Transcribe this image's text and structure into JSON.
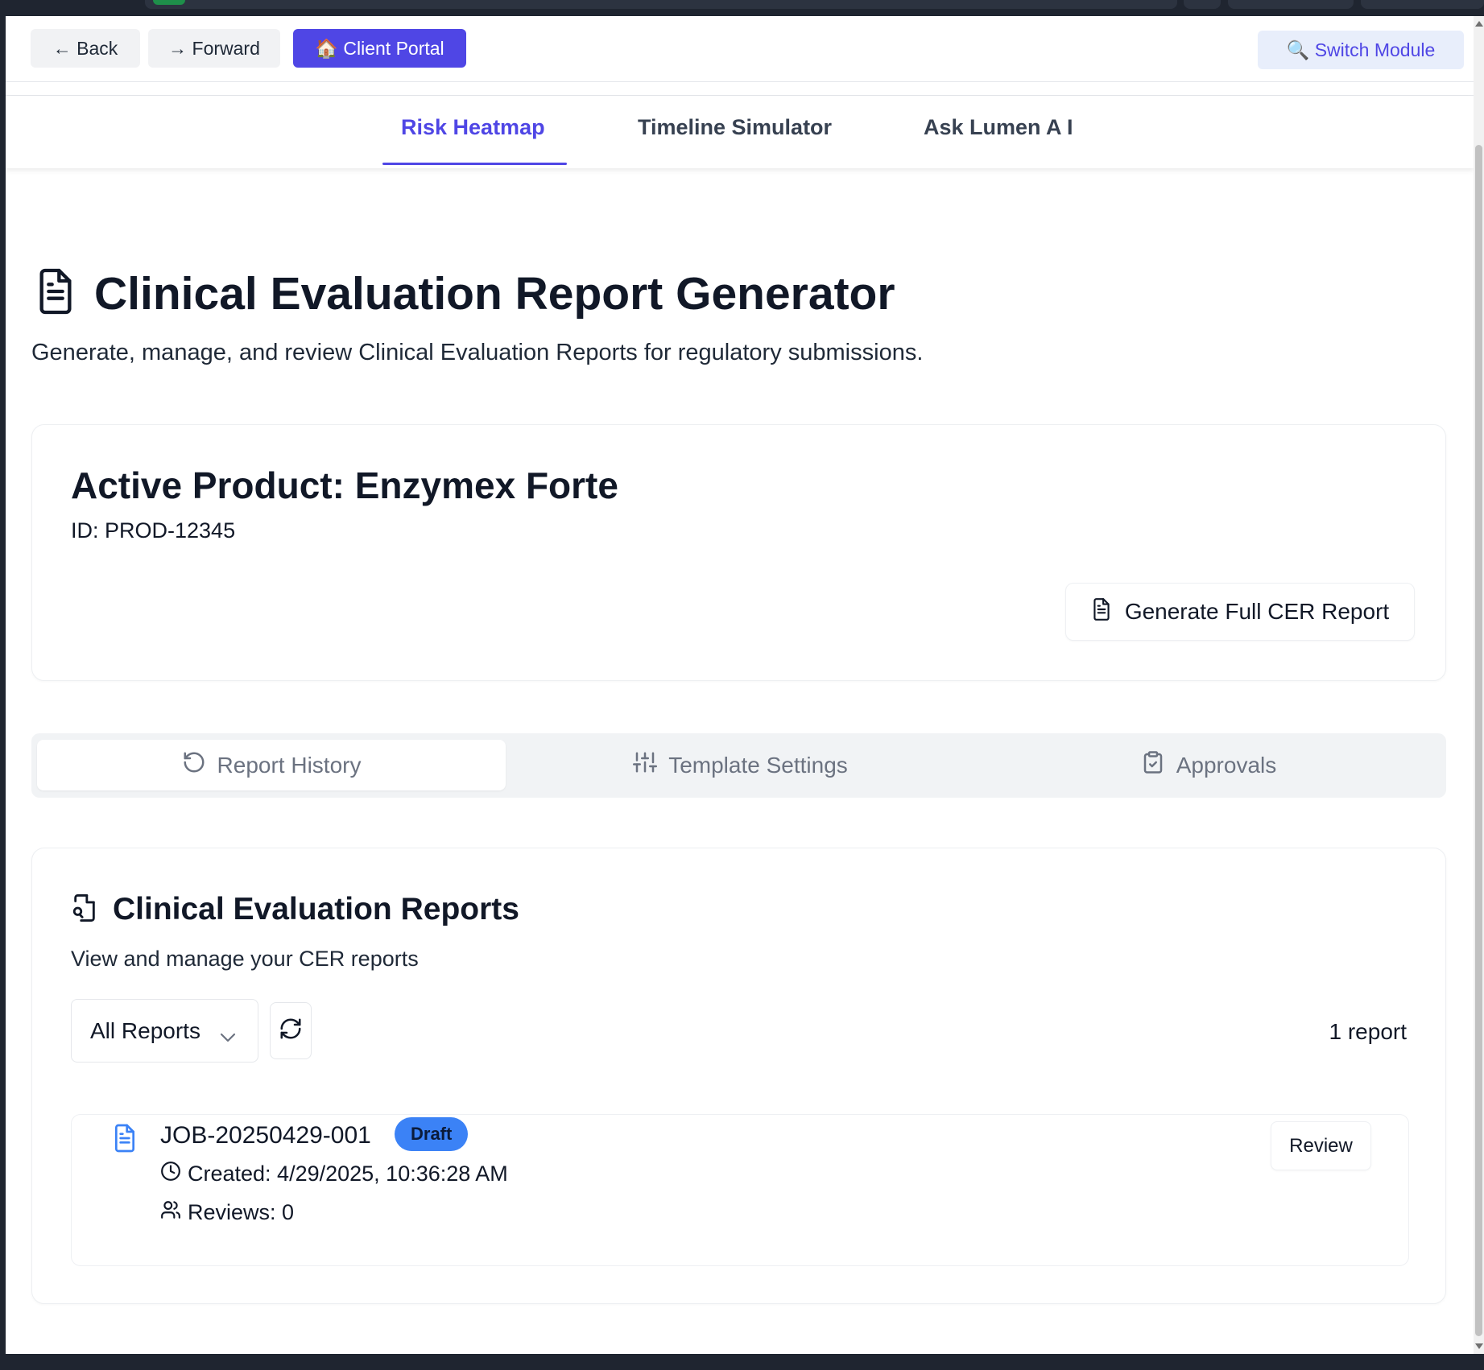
{
  "nav": {
    "back_label": "← Back",
    "forward_label": "→ Forward",
    "portal_label": "🏠 Client Portal",
    "switch_label": "🔍 Switch Module"
  },
  "subnav": {
    "tabs": [
      {
        "label": "Risk Heatmap",
        "active": true
      },
      {
        "label": "Timeline Simulator",
        "active": false
      },
      {
        "label": "Ask Lumen A I",
        "active": false
      }
    ]
  },
  "header": {
    "icon": "file-text-icon",
    "title": "Clinical Evaluation Report Generator",
    "subtitle": "Generate, manage, and review Clinical Evaluation Reports for regulatory submissions."
  },
  "product": {
    "name_line": "Active Product: Enzymex Forte",
    "id_line": "ID: PROD-12345",
    "generate_label": "Generate Full CER Report"
  },
  "section_tabs": [
    {
      "label": "Report History",
      "icon": "history-icon",
      "active": true
    },
    {
      "label": "Template Settings",
      "icon": "sliders-icon",
      "active": false
    },
    {
      "label": "Approvals",
      "icon": "clipboard-check-icon",
      "active": false
    }
  ],
  "reports": {
    "title": "Clinical Evaluation Reports",
    "subtitle": "View and manage your CER reports",
    "filter_value": "All Reports",
    "count_label": "1 report",
    "items": [
      {
        "job_id": "JOB-20250429-001",
        "status": "Draft",
        "created": "Created: 4/29/2025, 10:36:28 AM",
        "reviews": "Reviews: 0",
        "action_label": "Review"
      }
    ]
  },
  "colors": {
    "accent": "#4f46e5",
    "badge_draft": "#3b82f6",
    "doc_icon": "#3b82f6"
  }
}
